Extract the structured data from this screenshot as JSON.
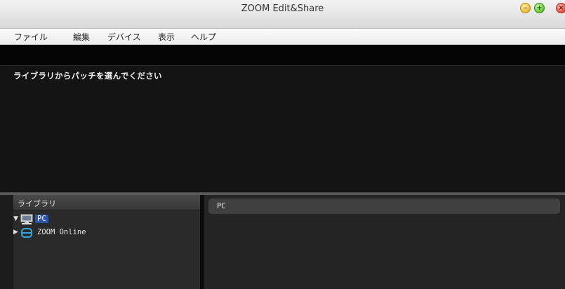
{
  "window": {
    "title": "ZOOM Edit&Share",
    "buttons": {
      "minimize": "–",
      "maximize": "+",
      "close": "×"
    }
  },
  "menu": {
    "items": [
      "ファイル",
      "編集",
      "デバイス",
      "表示",
      "ヘルプ"
    ]
  },
  "patch_area": {
    "message": "ライブラリからパッチを選んでください"
  },
  "library": {
    "header": "ライブラリ",
    "tree": [
      {
        "arrow": "▼",
        "icon": "computer-icon",
        "label": "PC",
        "selected": true
      },
      {
        "arrow": "▶",
        "icon": "cloud-drive-icon",
        "label": "ZOOM Online",
        "selected": false
      }
    ]
  },
  "content": {
    "header": "PC"
  },
  "colors": {
    "selection": "#2d54a8",
    "online_icon": "#2fa9e0",
    "background": "#1c1c1c"
  }
}
